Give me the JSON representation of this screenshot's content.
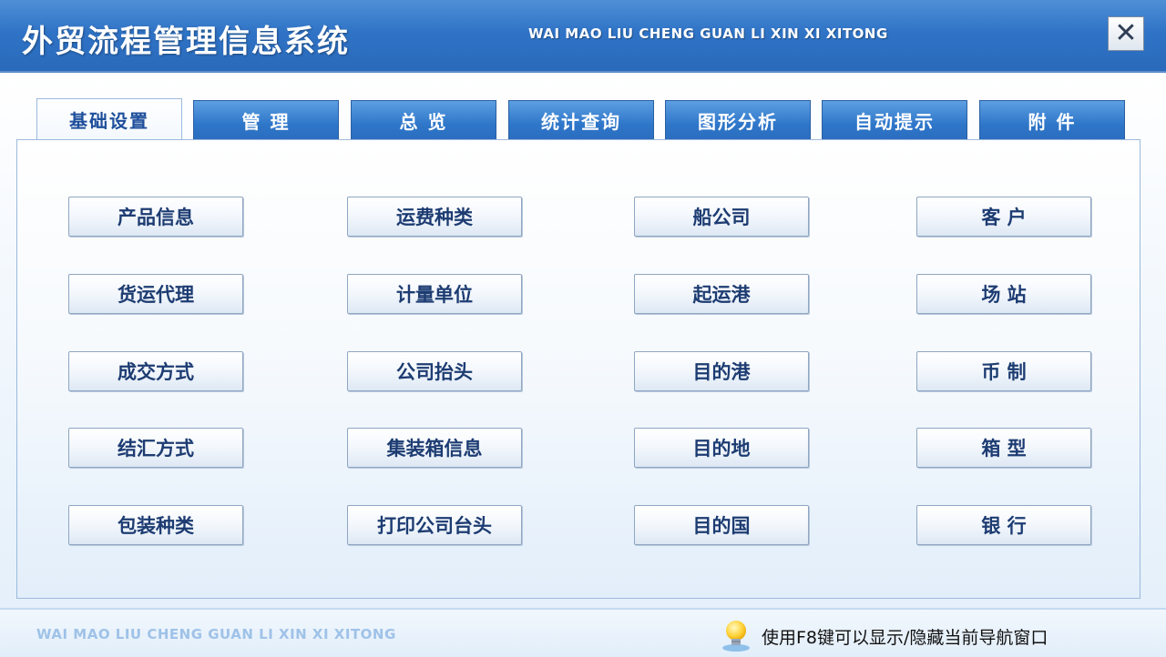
{
  "window": {
    "title_cn": "外贸流程管理信息系统",
    "title_en": "WAI MAO LIU CHENG GUAN LI XIN XI XITONG",
    "close_symbol": "✕"
  },
  "tabs": [
    {
      "label": "基础设置",
      "active": true
    },
    {
      "label": "管 理",
      "active": false
    },
    {
      "label": "总 览",
      "active": false
    },
    {
      "label": "统计查询",
      "active": false
    },
    {
      "label": "图形分析",
      "active": false
    },
    {
      "label": "自动提示",
      "active": false
    },
    {
      "label": "附 件",
      "active": false
    }
  ],
  "buttons": {
    "col1": [
      "产品信息",
      "货运代理",
      "成交方式",
      "结汇方式",
      "包装种类"
    ],
    "col2": [
      "运费种类",
      "计量单位",
      "公司抬头",
      "集装箱信息",
      "打印公司台头"
    ],
    "col3": [
      "船公司",
      "起运港",
      "目的港",
      "目的地",
      "目的国"
    ],
    "col4": [
      "客 户",
      "场 站",
      "币 制",
      "箱 型",
      "银 行"
    ]
  },
  "footer": {
    "brand_en": "WAI MAO LIU CHENG GUAN LI XIN XI XITONG",
    "hint": "使用F8键可以显示/隐藏当前导航窗口",
    "icon": "lightbulb-icon"
  },
  "colors": {
    "title_bar": "#2f73c6",
    "tab_blue": "#2e76c9",
    "button_text": "#1d3c72"
  }
}
